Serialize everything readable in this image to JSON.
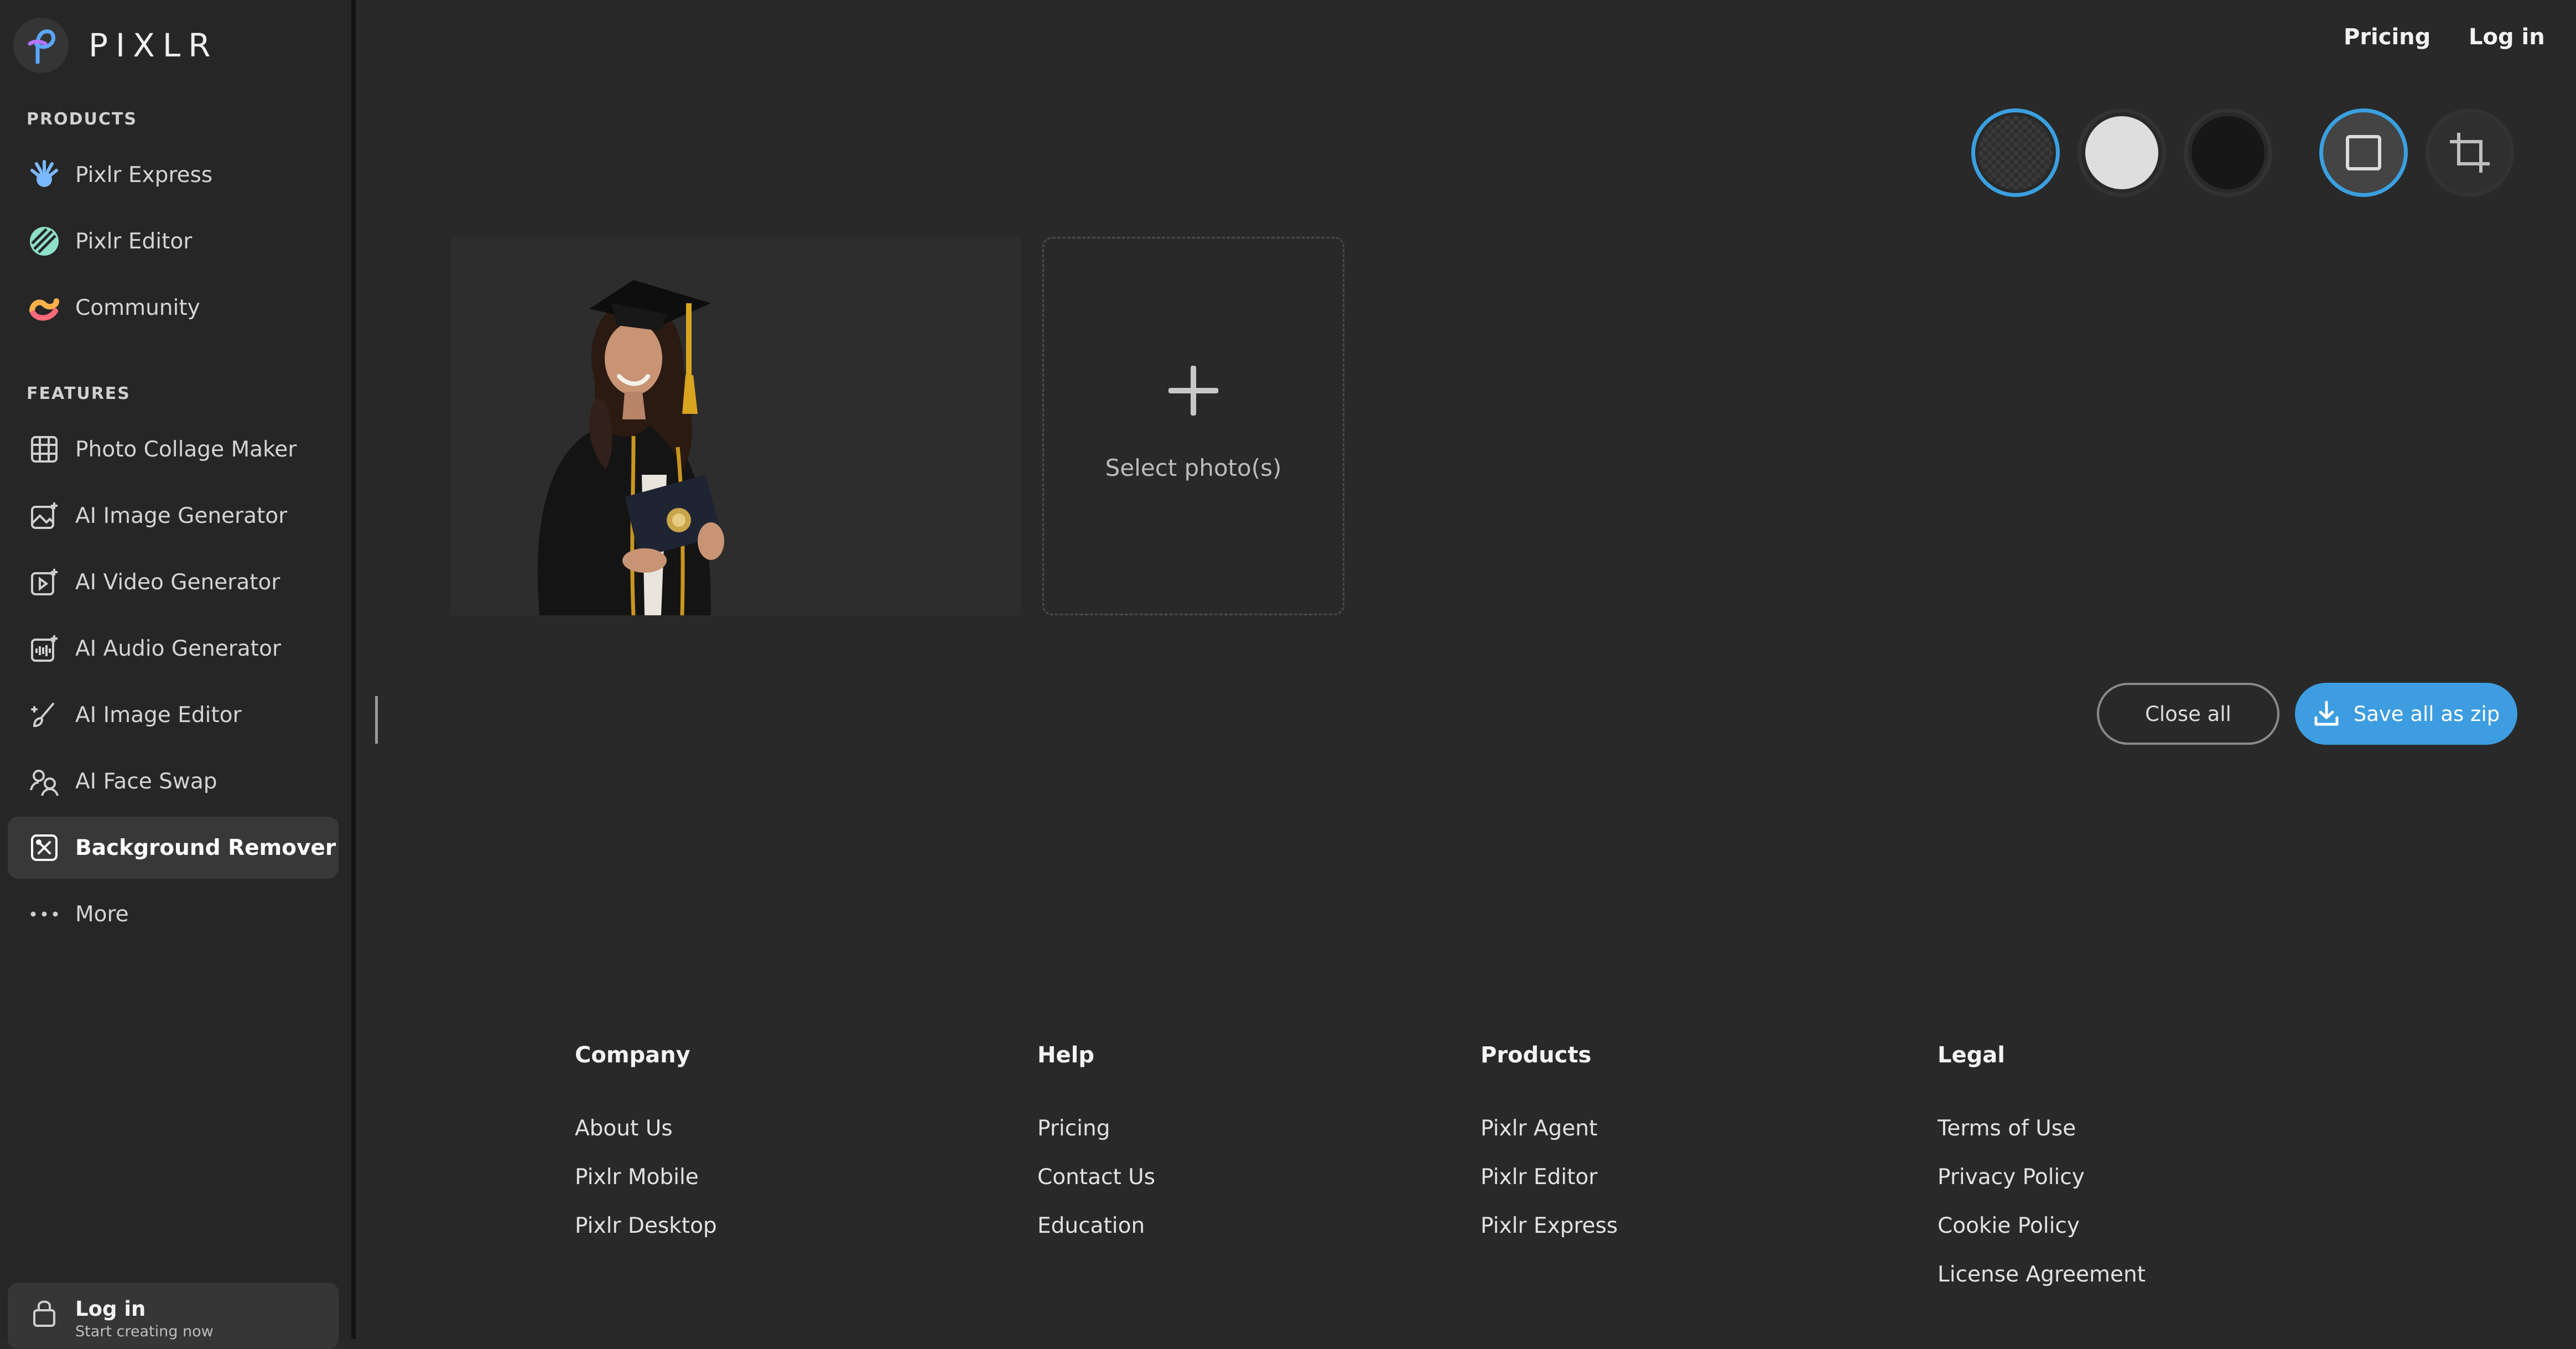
{
  "brand": {
    "name": "PIXLR"
  },
  "colors": {
    "accent": "#3d9de0",
    "background": "#292929",
    "sidebar": "#262626"
  },
  "sidebar": {
    "products_label": "PRODUCTS",
    "products": [
      {
        "label": "Pixlr Express",
        "icon": "pixlr-express-icon"
      },
      {
        "label": "Pixlr Editor",
        "icon": "pixlr-editor-icon"
      },
      {
        "label": "Community",
        "icon": "community-icon"
      }
    ],
    "features_label": "FEATURES",
    "features": [
      {
        "label": "Photo Collage Maker",
        "icon": "grid-icon"
      },
      {
        "label": "AI Image Generator",
        "icon": "ai-image-icon"
      },
      {
        "label": "AI Video Generator",
        "icon": "ai-video-icon"
      },
      {
        "label": "AI Audio Generator",
        "icon": "ai-audio-icon"
      },
      {
        "label": "AI Image Editor",
        "icon": "ai-brush-icon"
      },
      {
        "label": "AI Face Swap",
        "icon": "face-swap-icon"
      },
      {
        "label": "Background Remover",
        "icon": "bg-remover-icon",
        "active": true
      },
      {
        "label": "More",
        "icon": "more-icon"
      }
    ],
    "login": {
      "title": "Log in",
      "subtitle": "Start creating now"
    }
  },
  "topnav": {
    "pricing": "Pricing",
    "login": "Log in"
  },
  "toolbar": {
    "backgrounds": [
      "transparent",
      "white",
      "black"
    ],
    "selected_background": "transparent",
    "modes": [
      "square",
      "crop"
    ],
    "selected_mode": "square"
  },
  "main": {
    "select_label": "Select photo(s)",
    "close_all": "Close all",
    "save_all": "Save all as zip"
  },
  "footer": {
    "columns": [
      {
        "title": "Company",
        "links": [
          "About Us",
          "Pixlr Mobile",
          "Pixlr Desktop"
        ]
      },
      {
        "title": "Help",
        "links": [
          "Pricing",
          "Contact Us",
          "Education"
        ]
      },
      {
        "title": "Products",
        "links": [
          "Pixlr Agent",
          "Pixlr Editor",
          "Pixlr Express"
        ]
      },
      {
        "title": "Legal",
        "links": [
          "Terms of Use",
          "Privacy Policy",
          "Cookie Policy",
          "License Agreement"
        ]
      }
    ]
  }
}
